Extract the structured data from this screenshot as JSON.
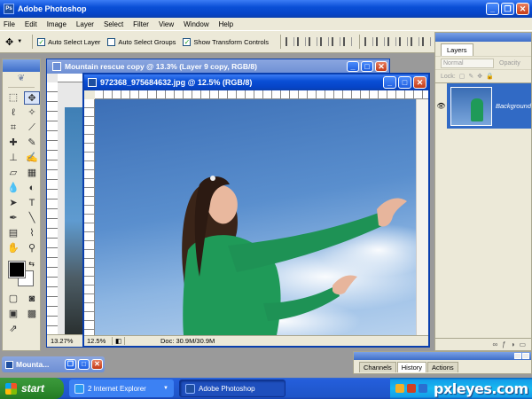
{
  "app": {
    "title": "Adobe Photoshop",
    "window_buttons": [
      "_",
      "❐",
      "✕"
    ]
  },
  "menu": [
    "File",
    "Edit",
    "Image",
    "Layer",
    "Select",
    "Filter",
    "View",
    "Window",
    "Help"
  ],
  "options_bar": {
    "auto_select_layer": {
      "label": "Auto Select Layer",
      "checked": true
    },
    "auto_select_groups": {
      "label": "Auto Select Groups",
      "checked": false
    },
    "show_transform_controls": {
      "label": "Show Transform Controls",
      "checked": true
    }
  },
  "toolbox": {
    "tools": [
      "marquee-icon",
      "move-icon",
      "lasso-icon",
      "magic-wand-icon",
      "crop-icon",
      "slice-icon",
      "healing-brush-icon",
      "brush-icon",
      "clone-stamp-icon",
      "history-brush-icon",
      "eraser-icon",
      "gradient-icon",
      "blur-icon",
      "dodge-icon",
      "path-selection-icon",
      "type-icon",
      "pen-icon",
      "line-icon",
      "notes-icon",
      "eyedropper-icon",
      "hand-icon",
      "zoom-icon"
    ],
    "foreground_color": "#000000",
    "background_color": "#ffffff"
  },
  "back_document": {
    "title": "Mountain rescue copy @ 13.3% (Layer 9 copy, RGB/8)",
    "zoom": "13.27%"
  },
  "front_document": {
    "title": "972368_975684632.jpg @ 12.5% (RGB/8)",
    "zoom": "12.5%",
    "doc_info": "Doc: 30.9M/30.9M"
  },
  "layers_panel": {
    "tab": "Layers",
    "blend_mode": "Normal",
    "opacity_label": "Opacity",
    "lock_label": "Lock:",
    "layer_name": "Background"
  },
  "history_panel": {
    "tabs": [
      "Channels",
      "History",
      "Actions"
    ],
    "active_tab": "History"
  },
  "minimized_window": {
    "title": "Mounta..."
  },
  "taskbar": {
    "start_label": "start",
    "tasks": [
      {
        "label": "2 Internet Explorer"
      },
      {
        "label": "Adobe Photoshop"
      }
    ],
    "watermark": "pxleyes.com"
  },
  "colors": {
    "title_bar": "#0a4fd6",
    "panel_bg": "#ece9d8",
    "sky": "#5a8fce",
    "sweater": "#1f9a58",
    "start_green": "#2e8a2e"
  }
}
